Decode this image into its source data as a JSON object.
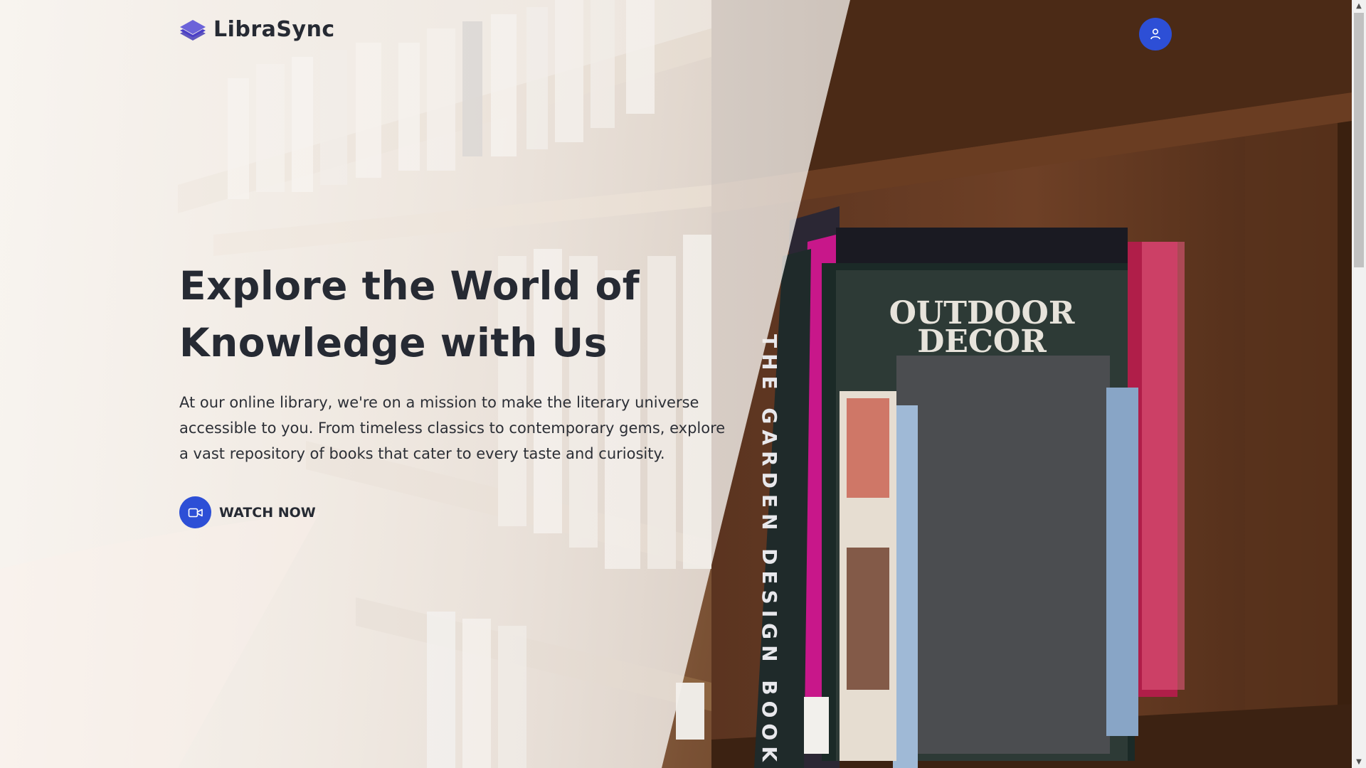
{
  "brand": {
    "name": "LibraSync",
    "logo_icon": "layers-icon",
    "accent_color": "#2d4fd6"
  },
  "header": {
    "user_icon": "user-icon"
  },
  "hero": {
    "title_line1": "Explore the World of",
    "title_line2": "Knowledge with Us",
    "description": "At our online library, we're on a mission to make the literary universe accessible to you. From timeless classics to contemporary gems, explore a vast repository of books that cater to every taste and curiosity.",
    "cta_label": "WATCH NOW",
    "cta_icon": "video-camera-icon"
  },
  "background": {
    "book_title": "OUTDOOR DECOR",
    "book_spine": "THE GARDEN DESIGN BOOK"
  },
  "scrollbar": {
    "up_arrow": "▲",
    "down_arrow": "▼"
  }
}
